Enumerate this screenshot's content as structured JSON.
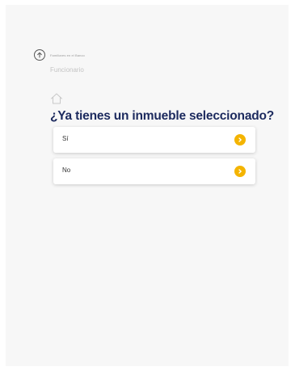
{
  "header": {
    "back_icon": "arrow-up-circle-icon",
    "previous_step": "Familiares en el Banco",
    "section": "Funcionario"
  },
  "main": {
    "house_icon": "house-outline-icon",
    "question": "¿Ya tienes un inmueble seleccionado?",
    "options": [
      {
        "label": "Sí",
        "icon": "chevron-right-circle-icon"
      },
      {
        "label": "No",
        "icon": "chevron-right-circle-icon"
      }
    ]
  },
  "colors": {
    "question_text": "#1c2a5e",
    "accent": "#f4b400",
    "background": "#f7f7f7"
  }
}
